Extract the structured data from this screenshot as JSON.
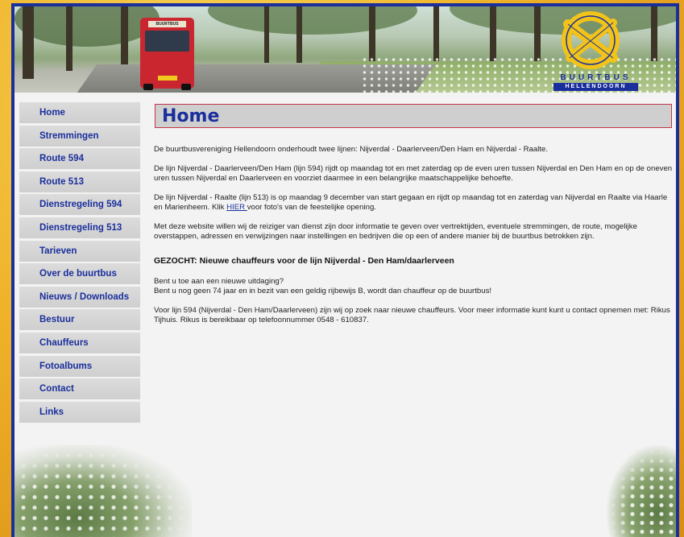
{
  "header": {
    "bus_sign": "BUURTBUS",
    "logo_text": "BUURTBUS",
    "logo_subtext": "HELLENDOORN"
  },
  "nav": {
    "items": [
      {
        "label": "Home"
      },
      {
        "label": "Stremmingen"
      },
      {
        "label": "Route 594"
      },
      {
        "label": "Route 513"
      },
      {
        "label": "Dienstregeling 594"
      },
      {
        "label": "Dienstregeling 513"
      },
      {
        "label": "Tarieven"
      },
      {
        "label": "Over de buurtbus"
      },
      {
        "label": "Nieuws / Downloads"
      },
      {
        "label": "Bestuur"
      },
      {
        "label": "Chauffeurs"
      },
      {
        "label": "Fotoalbums"
      },
      {
        "label": "Contact"
      },
      {
        "label": "Links"
      }
    ]
  },
  "main": {
    "title": "Home",
    "p1": "De buurtbusvereniging Hellendoorn onderhoudt twee lijnen: Nijverdal - Daarlerveen/Den Ham en Nijverdal - Raalte.",
    "p2": "De lijn Nijverdal - Daarlerveen/Den Ham (lijn 594) rijdt op maandag tot en met zaterdag op de even uren tussen Nijverdal en Den Ham en op de oneven uren tussen Nijverdal en Daarlerveen en voorziet daarmee in een belangrijke maatschappelijke behoefte.",
    "p3_before": "De lijn Nijverdal - Raalte (lijn 513) is op maandag 9 december van start gegaan en rijdt op maandag tot en zaterdag van Nijverdal en Raalte via Haarle en Marienheem. Klik ",
    "p3_link": "HIER ",
    "p3_after": "voor foto's van de feestelijke opening.",
    "p4": "Met deze website willen wij de reiziger van dienst zijn door informatie te geven over vertrektijden, eventuele stremmingen, de route, mogelijke overstappen, adressen en verwijzingen naar instellingen en bedrijven die op een of andere manier bij de buurtbus betrokken zijn.",
    "heading": "GEZOCHT: Nieuwe chauffeurs voor de lijn Nijverdal - Den Ham/daarlerveen",
    "p5_line1": "Bent u toe aan een nieuwe uitdaging?",
    "p5_line2": "Bent u nog geen 74 jaar en in bezit van een geldig rijbewijs B, wordt dan chauffeur op de buurtbus!",
    "p6": "Voor lijn 594 (Nijverdal - Den Ham/Daarlerveen) zijn wij op zoek naar nieuwe chauffeurs. Voor meer informatie kunt kunt u contact opnemen met: Rikus Tijhuis. Rikus is bereikbaar op telefoonnummer 0548 - 610837."
  },
  "colors": {
    "accent": "#1a2f9c",
    "logo_yellow": "#f2c318",
    "title_border": "#c23548",
    "bus_red": "#c9262f"
  }
}
